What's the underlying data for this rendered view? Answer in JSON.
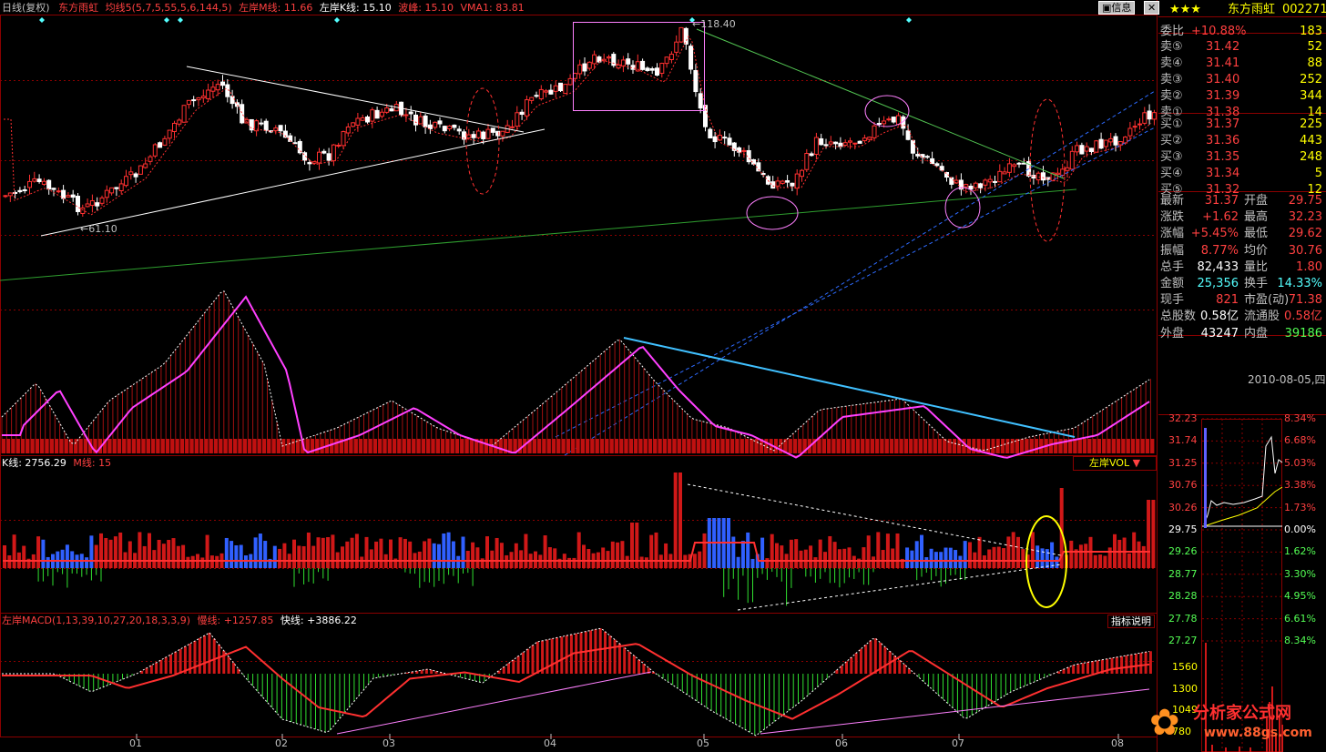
{
  "header": {
    "period": "日线(复权)",
    "stock_name": "东方雨虹",
    "ma_label": "均线5(5,7,5,55,5,6,144,5)",
    "m_line": "左岸M线: 11.66",
    "k_line": "左岸K线: 15.10",
    "peak": "波峰: 15.10",
    "vma": "VMA1: 83.81"
  },
  "buttons": {
    "info": "信息"
  },
  "annotations": {
    "high_price": "118.40",
    "low_price": "61.10"
  },
  "panel2": {
    "k_line": "K线: 2756.29",
    "m_line": "M线: 15",
    "indicator_select": "左岸VOL"
  },
  "panel3": {
    "macd_label": "左岸MACD(1,13,39,10,27,20,18,3,3,9)",
    "slow": "慢线: +1257.85",
    "fast": "快线: +3886.22",
    "help_button": "指标说明"
  },
  "xaxis": [
    "01",
    "02",
    "03",
    "04",
    "05",
    "06",
    "07",
    "08"
  ],
  "quote": {
    "stars": "★★★",
    "name": "东方雨虹",
    "code": "002271",
    "weibi_label": "委比",
    "weibi_value": "+10.88%",
    "weibi_vol": "183",
    "sell": [
      {
        "label": "卖⑤",
        "price": "31.42",
        "vol": "52"
      },
      {
        "label": "卖④",
        "price": "31.41",
        "vol": "88"
      },
      {
        "label": "卖③",
        "price": "31.40",
        "vol": "252"
      },
      {
        "label": "卖②",
        "price": "31.39",
        "vol": "344"
      },
      {
        "label": "卖①",
        "price": "31.38",
        "vol": "14"
      }
    ],
    "buy": [
      {
        "label": "买①",
        "price": "31.37",
        "vol": "225"
      },
      {
        "label": "买②",
        "price": "31.36",
        "vol": "443"
      },
      {
        "label": "买③",
        "price": "31.35",
        "vol": "248"
      },
      {
        "label": "买④",
        "price": "31.34",
        "vol": "5"
      },
      {
        "label": "买⑤",
        "price": "31.32",
        "vol": "12"
      }
    ],
    "stats": [
      {
        "l1": "最新",
        "v1": "31.37",
        "l2": "开盘",
        "v2": "29.75"
      },
      {
        "l1": "涨跌",
        "v1": "+1.62",
        "l2": "最高",
        "v2": "32.23"
      },
      {
        "l1": "涨幅",
        "v1": "+5.45%",
        "l2": "最低",
        "v2": "29.62"
      },
      {
        "l1": "振幅",
        "v1": "8.77%",
        "l2": "均价",
        "v2": "30.76"
      },
      {
        "l1": "总手",
        "v1": "82,433",
        "l2": "量比",
        "v2": "1.80"
      },
      {
        "l1": "金额",
        "v1": "25,356",
        "l2": "换手",
        "v2": "14.33%"
      },
      {
        "l1": "现手",
        "v1": "821",
        "l2": "市盈(动)",
        "v2": "71.38"
      },
      {
        "l1": "总股数",
        "v1": "0.58亿",
        "l2": "流通股",
        "v2": "0.58亿"
      },
      {
        "l1": "外盘",
        "v1": "43247",
        "l2": "内盘",
        "v2": "39186"
      }
    ],
    "date": "2010-08-05,四"
  },
  "intraday": {
    "price_ticks": [
      "32.23",
      "31.74",
      "31.25",
      "30.76",
      "30.26",
      "29.75",
      "29.26",
      "28.77",
      "28.28",
      "27.78",
      "27.27"
    ],
    "pct_ticks": [
      "8.34%",
      "6.68%",
      "5.03%",
      "3.38%",
      "1.73%",
      "0.00%",
      "1.62%",
      "3.30%",
      "4.95%",
      "6.61%",
      "8.34%"
    ],
    "vol_ticks": [
      "1560",
      "1300",
      "1049",
      "780"
    ]
  },
  "watermark": {
    "title": "分析家公式网",
    "url": "www.88gs.com"
  },
  "colors": {
    "up": "#ff3030",
    "down": "#54ffff",
    "accent": "#ffff00",
    "panel_border": "#8b0000"
  }
}
